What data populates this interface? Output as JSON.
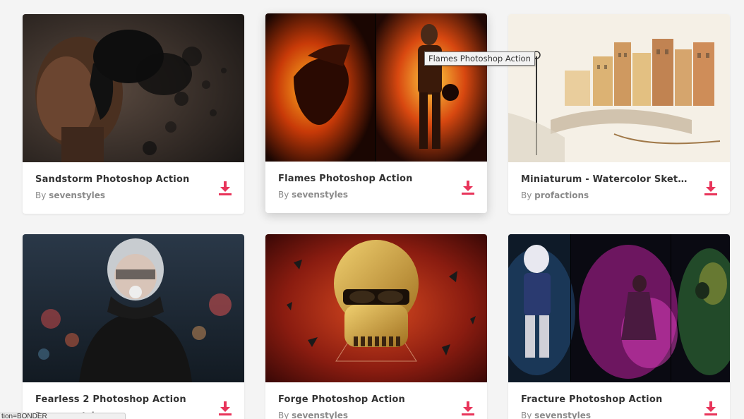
{
  "tooltip": "Flames Photoshop Action",
  "status_bar": "tion=BONDER",
  "accent_color": "#e8345a",
  "cards": [
    {
      "title": "Sandstorm Photoshop Action",
      "by": "By",
      "author": "sevenstyles",
      "icon": "download-icon"
    },
    {
      "title": "Flames Photoshop Action",
      "by": "By",
      "author": "sevenstyles",
      "icon": "download-icon"
    },
    {
      "title": "Miniaturum - Watercolor Sketc...",
      "by": "By",
      "author": "profactions",
      "icon": "download-icon"
    },
    {
      "title": "Fearless 2 Photoshop Action",
      "by": "By",
      "author": "sevenstyles",
      "icon": "download-icon"
    },
    {
      "title": "Forge Photoshop Action",
      "by": "By",
      "author": "sevenstyles",
      "icon": "download-icon"
    },
    {
      "title": "Fracture Photoshop Action",
      "by": "By",
      "author": "sevenstyles",
      "icon": "download-icon"
    }
  ]
}
